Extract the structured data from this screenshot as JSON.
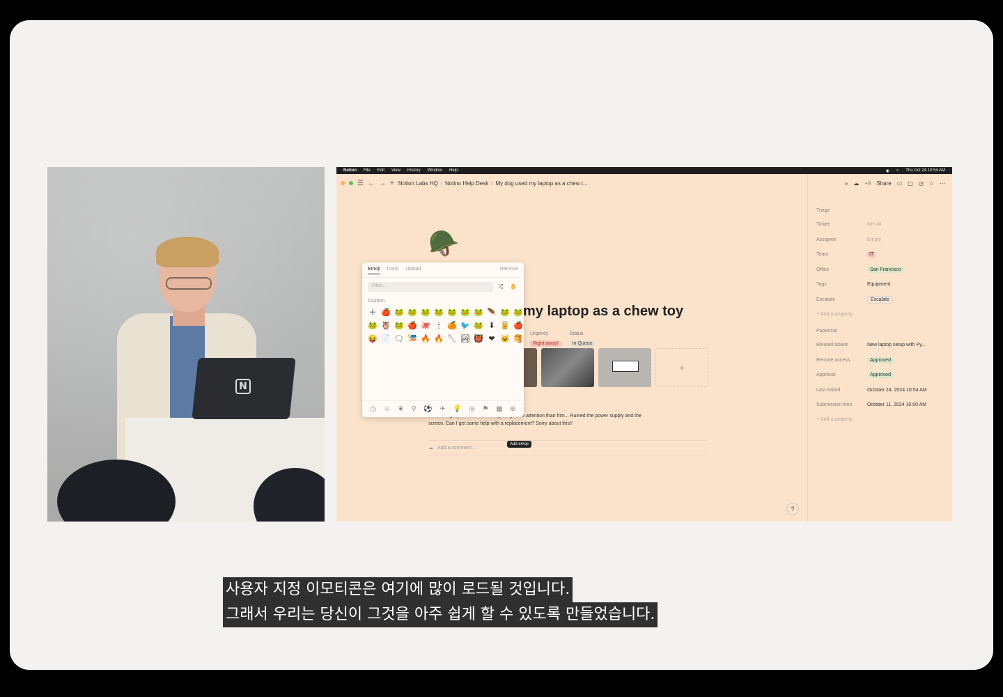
{
  "menubar": {
    "items": [
      "Notion",
      "File",
      "Edit",
      "View",
      "History",
      "Window",
      "Help"
    ],
    "clock": "Thu Oct 24  10:54 AM"
  },
  "breadcrumb": {
    "items": [
      "Notion Labs HQ",
      "Notino Help Desk",
      "My dog used my laptop as a chew t..."
    ]
  },
  "topbar": {
    "collab_count": "+9",
    "share_label": "Share"
  },
  "page": {
    "icon": "🪖",
    "title_visible": "my laptop as a chew toy",
    "urgency_label": "Urgency",
    "urgency_value": "Right away!",
    "status_label": "Status",
    "status_value": "In Queue",
    "description_line1": "I think he got jealous that the ... getting more attention than him... Ruined the power supply and the",
    "description_line2": "screen. Can I get some help with a replacement? Sorry about this!!",
    "comment_placeholder": "Add a comment..."
  },
  "emoji_picker": {
    "tabs": [
      "Emoji",
      "Icons",
      "Upload"
    ],
    "remove_label": "Remove",
    "filter_placeholder": "Filter...",
    "section_label": "Custom",
    "tooltip": "Add emoji",
    "emojis": [
      "＋",
      "🍎",
      "🐸",
      "🐸",
      "🐸",
      "🐸",
      "🐸",
      "🐸",
      "🐸",
      "🪶",
      "🐸",
      "🐸",
      "🐸",
      "🦉",
      "🐸",
      "🍎",
      "🐙",
      "🕯",
      "🍊",
      "🐦",
      "🐸",
      "⬇",
      "🥫",
      "🍎",
      "😝",
      "📄",
      "🗨",
      "🎏",
      "🔥",
      "🔥",
      "🥄",
      "🏞",
      "👹",
      "❤",
      "🐱",
      "🥞"
    ]
  },
  "sidebar": {
    "section1": "Triage",
    "rows": [
      {
        "k": "Ticket",
        "v": "NH-40"
      },
      {
        "k": "Assignee",
        "v": "Empty"
      },
      {
        "k": "Team",
        "v": "IT"
      },
      {
        "k": "Office",
        "v": "San Francisco"
      },
      {
        "k": "Tags",
        "v": "Equipment"
      },
      {
        "k": "Escalate",
        "v": "Escalate"
      }
    ],
    "add_property": "Add a property",
    "section2": "Papertrail",
    "rows2": [
      {
        "k": "Related tickets",
        "v": "New laptop setup with Py..."
      },
      {
        "k": "Remote access",
        "v": "Approved"
      },
      {
        "k": "Approval",
        "v": "Approved"
      },
      {
        "k": "Last edited",
        "v": "October 24, 2024 10:54 AM"
      },
      {
        "k": "Submission time",
        "v": "October 11, 2024 10:00 AM"
      }
    ]
  },
  "subtitles": {
    "line1": "사용자 지정 이모티콘은 여기에 많이 로드될 것입니다.",
    "line2": "그래서 우리는 당신이 그것을 아주 쉽게 할 수 있도록 만들었습니다."
  },
  "colors": {
    "screen_bg": "#fbe3cb",
    "accent_red": "#b23b2b",
    "accent_green": "#3e6b2e"
  }
}
